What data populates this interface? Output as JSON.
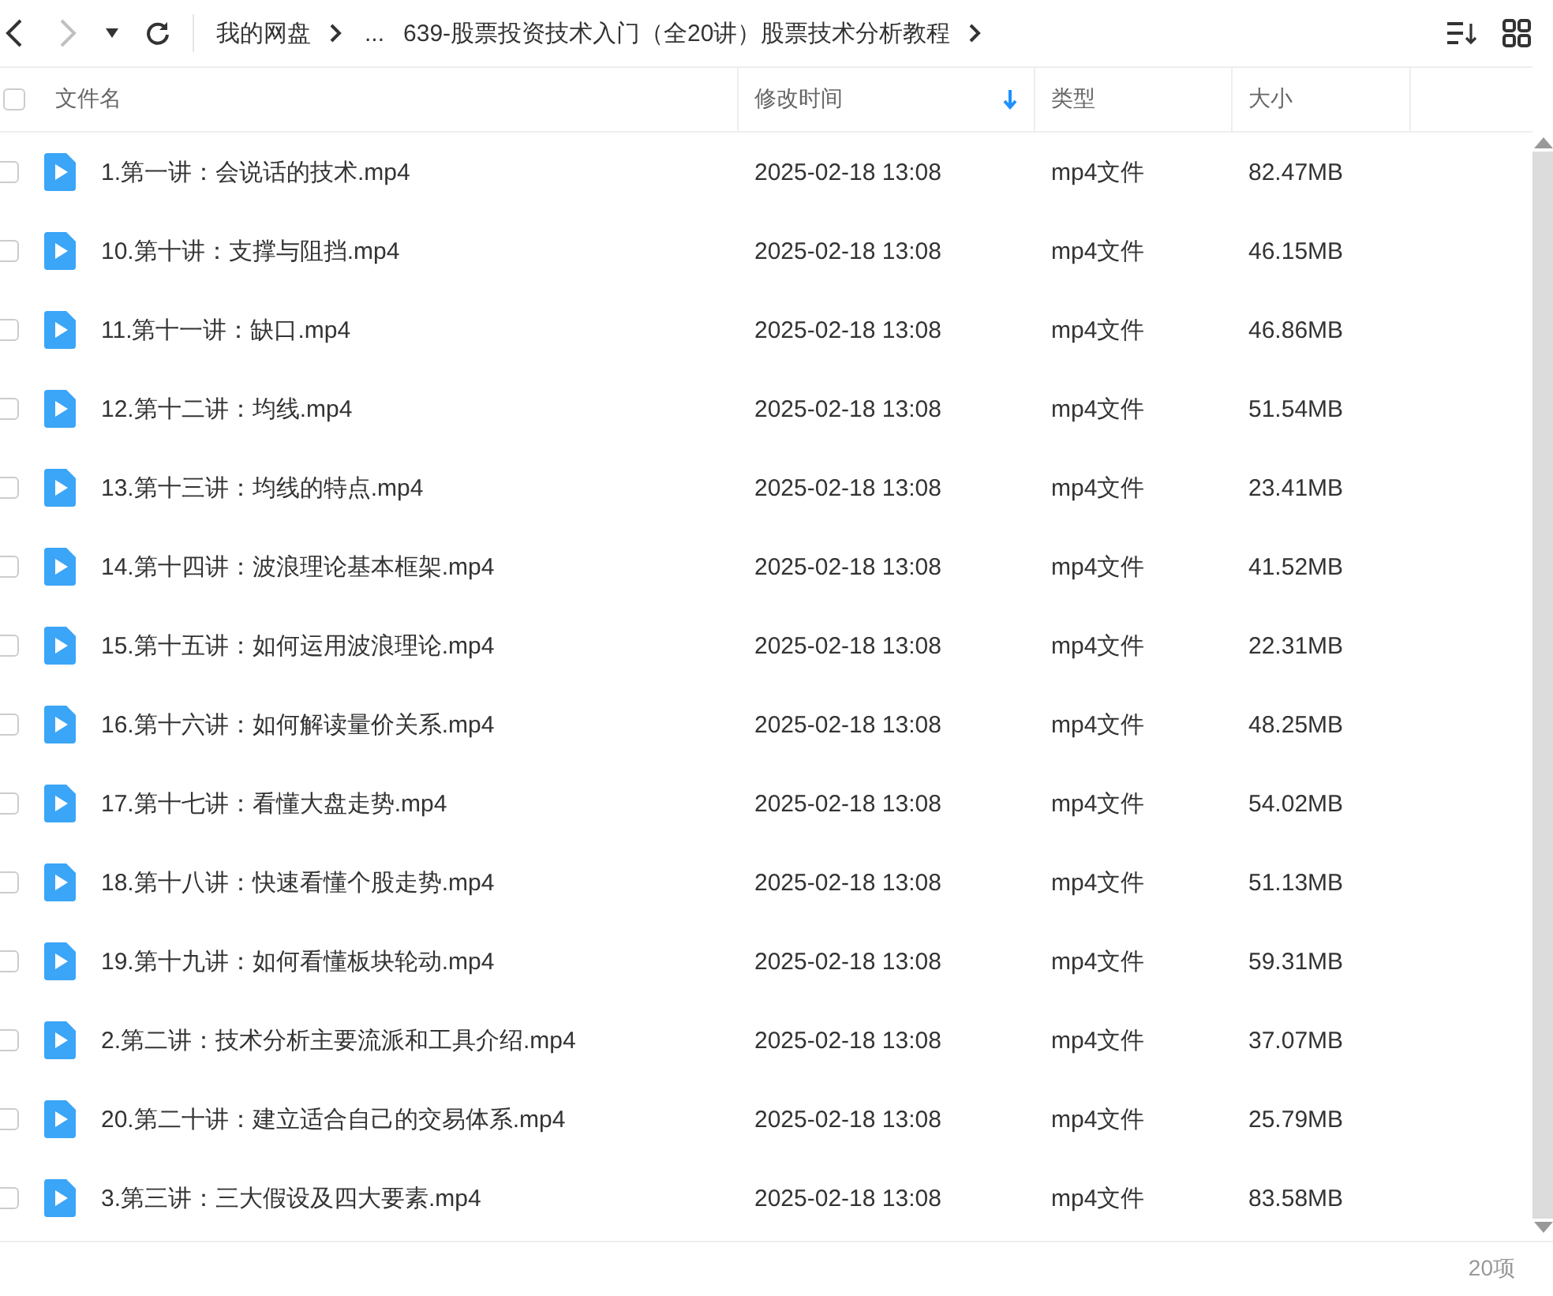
{
  "toolbar": {
    "back_disabled": false,
    "forward_disabled": true
  },
  "breadcrumb": [
    "我的网盘",
    "...",
    "639-股票投资技术入门（全20讲）股票技术分析教程"
  ],
  "table": {
    "select_all_checked": false,
    "columns": [
      {
        "label": "文件名",
        "sorted": false
      },
      {
        "label": "修改时间",
        "sorted": true
      },
      {
        "label": "类型",
        "sorted": false
      },
      {
        "label": "大小",
        "sorted": false
      }
    ],
    "rows": [
      {
        "name": "1.第一讲：会说话的技术.mp4",
        "modified": "2025-02-18 13:08",
        "type": "mp4文件",
        "size": "82.47MB",
        "checked": false
      },
      {
        "name": "10.第十讲：支撑与阻挡.mp4",
        "modified": "2025-02-18 13:08",
        "type": "mp4文件",
        "size": "46.15MB",
        "checked": false
      },
      {
        "name": "11.第十一讲：缺口.mp4",
        "modified": "2025-02-18 13:08",
        "type": "mp4文件",
        "size": "46.86MB",
        "checked": false
      },
      {
        "name": "12.第十二讲：均线.mp4",
        "modified": "2025-02-18 13:08",
        "type": "mp4文件",
        "size": "51.54MB",
        "checked": false
      },
      {
        "name": "13.第十三讲：均线的特点.mp4",
        "modified": "2025-02-18 13:08",
        "type": "mp4文件",
        "size": "23.41MB",
        "checked": false
      },
      {
        "name": "14.第十四讲：波浪理论基本框架.mp4",
        "modified": "2025-02-18 13:08",
        "type": "mp4文件",
        "size": "41.52MB",
        "checked": false
      },
      {
        "name": "15.第十五讲：如何运用波浪理论.mp4",
        "modified": "2025-02-18 13:08",
        "type": "mp4文件",
        "size": "22.31MB",
        "checked": false
      },
      {
        "name": "16.第十六讲：如何解读量价关系.mp4",
        "modified": "2025-02-18 13:08",
        "type": "mp4文件",
        "size": "48.25MB",
        "checked": false
      },
      {
        "name": "17.第十七讲：看懂大盘走势.mp4",
        "modified": "2025-02-18 13:08",
        "type": "mp4文件",
        "size": "54.02MB",
        "checked": false
      },
      {
        "name": "18.第十八讲：快速看懂个股走势.mp4",
        "modified": "2025-02-18 13:08",
        "type": "mp4文件",
        "size": "51.13MB",
        "checked": false
      },
      {
        "name": "19.第十九讲：如何看懂板块轮动.mp4",
        "modified": "2025-02-18 13:08",
        "type": "mp4文件",
        "size": "59.31MB",
        "checked": false
      },
      {
        "name": "2.第二讲：技术分析主要流派和工具介绍.mp4",
        "modified": "2025-02-18 13:08",
        "type": "mp4文件",
        "size": "37.07MB",
        "checked": false
      },
      {
        "name": "20.第二十讲：建立适合自己的交易体系.mp4",
        "modified": "2025-02-18 13:08",
        "type": "mp4文件",
        "size": "25.79MB",
        "checked": false
      },
      {
        "name": "3.第三讲：三大假设及四大要素.mp4",
        "modified": "2025-02-18 13:08",
        "type": "mp4文件",
        "size": "83.58MB",
        "checked": false
      }
    ]
  },
  "status_bar": {
    "count": "20项"
  }
}
